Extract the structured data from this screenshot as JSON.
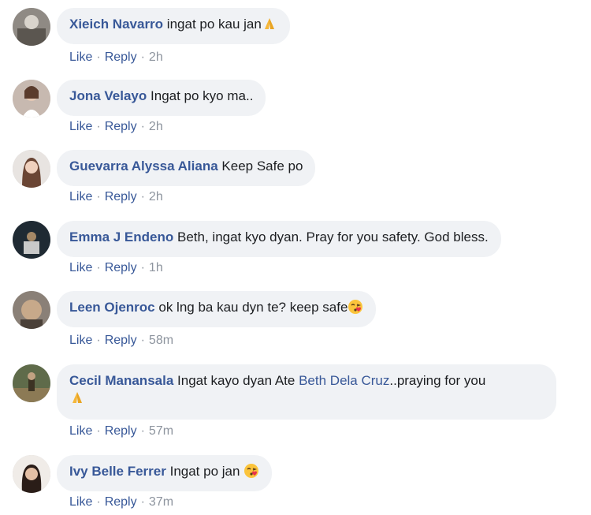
{
  "comments": [
    {
      "author": "Xieich Navarro",
      "text": "ingat po kau jan",
      "emoji": "folded-hands",
      "like": "Like",
      "reply": "Reply",
      "time": "2h"
    },
    {
      "author": "Jona Velayo",
      "text": "Ingat po kyo ma..",
      "like": "Like",
      "reply": "Reply",
      "time": "2h"
    },
    {
      "author": "Guevarra Alyssa Aliana",
      "text": "Keep Safe po",
      "like": "Like",
      "reply": "Reply",
      "time": "2h"
    },
    {
      "author": "Emma J Endeno",
      "text": "Beth, ingat kyo dyan. Pray for you safety. God bless.",
      "like": "Like",
      "reply": "Reply",
      "time": "1h"
    },
    {
      "author": "Leen Ojenroc",
      "text": "ok lng ba kau dyn te? keep safe",
      "emoji": "face-blowing-kiss",
      "like": "Like",
      "reply": "Reply",
      "time": "58m"
    },
    {
      "author": "Cecil Manansala",
      "text_before": "Ingat kayo dyan Ate",
      "mention": "Beth Dela Cruz",
      "text_after": "..praying for you",
      "emoji": "folded-hands",
      "like": "Like",
      "reply": "Reply",
      "time": "57m"
    },
    {
      "author": "Ivy Belle Ferrer",
      "text": "Ingat po jan",
      "emoji": "face-blowing-kiss",
      "like": "Like",
      "reply": "Reply",
      "time": "37m"
    }
  ],
  "colors": {
    "link": "#385898",
    "bubble": "#f0f2f5",
    "meta": "#8d949e",
    "text": "#1c1e21"
  }
}
